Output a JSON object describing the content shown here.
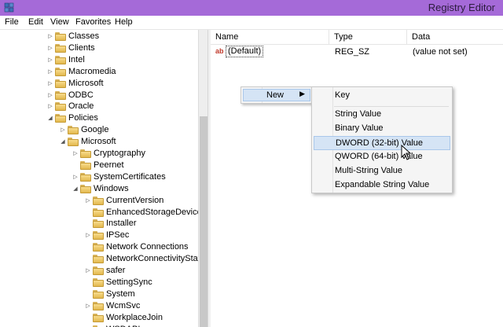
{
  "window": {
    "title": "Registry Editor",
    "icon": "registry-icon"
  },
  "menu": [
    "File",
    "Edit",
    "View",
    "Favorites",
    "Help"
  ],
  "tree": [
    {
      "label": "Classes",
      "depth": 0,
      "expander": "collapsed"
    },
    {
      "label": "Clients",
      "depth": 0,
      "expander": "collapsed"
    },
    {
      "label": "Intel",
      "depth": 0,
      "expander": "collapsed"
    },
    {
      "label": "Macromedia",
      "depth": 0,
      "expander": "collapsed"
    },
    {
      "label": "Microsoft",
      "depth": 0,
      "expander": "collapsed"
    },
    {
      "label": "ODBC",
      "depth": 0,
      "expander": "collapsed"
    },
    {
      "label": "Oracle",
      "depth": 0,
      "expander": "collapsed"
    },
    {
      "label": "Policies",
      "depth": 0,
      "expander": "expanded"
    },
    {
      "label": "Google",
      "depth": 1,
      "expander": "collapsed"
    },
    {
      "label": "Microsoft",
      "depth": 1,
      "expander": "expanded"
    },
    {
      "label": "Cryptography",
      "depth": 2,
      "expander": "collapsed"
    },
    {
      "label": "Peernet",
      "depth": 2,
      "expander": "none"
    },
    {
      "label": "SystemCertificates",
      "depth": 2,
      "expander": "collapsed"
    },
    {
      "label": "Windows",
      "depth": 2,
      "expander": "expanded"
    },
    {
      "label": "CurrentVersion",
      "depth": 3,
      "expander": "collapsed"
    },
    {
      "label": "EnhancedStorageDevices",
      "depth": 3,
      "expander": "none"
    },
    {
      "label": "Installer",
      "depth": 3,
      "expander": "none"
    },
    {
      "label": "IPSec",
      "depth": 3,
      "expander": "collapsed"
    },
    {
      "label": "Network Connections",
      "depth": 3,
      "expander": "none"
    },
    {
      "label": "NetworkConnectivityStatu",
      "depth": 3,
      "expander": "none"
    },
    {
      "label": "safer",
      "depth": 3,
      "expander": "collapsed"
    },
    {
      "label": "SettingSync",
      "depth": 3,
      "expander": "none"
    },
    {
      "label": "System",
      "depth": 3,
      "expander": "none"
    },
    {
      "label": "WcmSvc",
      "depth": 3,
      "expander": "collapsed"
    },
    {
      "label": "WorkplaceJoin",
      "depth": 3,
      "expander": "none"
    },
    {
      "label": "WSDAPI",
      "depth": 3,
      "expander": "collapsed"
    }
  ],
  "columns": {
    "name": "Name",
    "type": "Type",
    "data": "Data"
  },
  "values": [
    {
      "name": "(Default)",
      "type": "REG_SZ",
      "data": "(value not set)",
      "icon": "string-value-icon"
    }
  ],
  "context_menu": {
    "label": "New"
  },
  "submenu": [
    {
      "label": "Key",
      "highlighted": false
    },
    {
      "label": "String Value",
      "highlighted": false
    },
    {
      "label": "Binary Value",
      "highlighted": false
    },
    {
      "label": "DWORD (32-bit) Value",
      "highlighted": true
    },
    {
      "label": "QWORD (64-bit) Value",
      "highlighted": false
    },
    {
      "label": "Multi-String Value",
      "highlighted": false
    },
    {
      "label": "Expandable String Value",
      "highlighted": false
    }
  ]
}
